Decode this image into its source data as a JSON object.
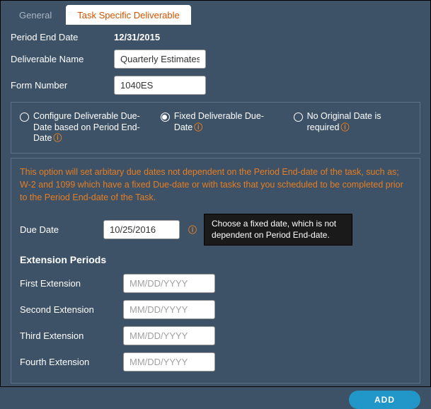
{
  "tabs": {
    "general": "General",
    "task_specific": "Task Specific Deliverable"
  },
  "fields": {
    "period_end_label": "Period End Date",
    "period_end_value": "12/31/2015",
    "deliverable_name_label": "Deliverable Name",
    "deliverable_name_value": "Quarterly Estimates",
    "form_number_label": "Form Number",
    "form_number_value": "1040ES"
  },
  "radios": {
    "configure": "Configure Deliverable Due-Date based on Period End-Date",
    "fixed": "Fixed Deliverable Due-Date",
    "no_original": "No Original Date is required"
  },
  "help_text": "This option will set arbitary due dates not dependent on the Period End-date of the task, such as; W-2 and 1099 which have a fixed Due-date or with tasks that you scheduled to be completed prior to the Period End-date of the Task.",
  "due_date": {
    "label": "Due Date",
    "value": "10/25/2016",
    "tooltip": "Choose a fixed date, which is not dependent on Period End-date."
  },
  "extensions": {
    "title": "Extension Periods",
    "first": "First Extension",
    "second": "Second Extension",
    "third": "Third Extension",
    "fourth": "Fourth Extension",
    "placeholder": "MM/DD/YYYY"
  },
  "buttons": {
    "add": "ADD"
  }
}
